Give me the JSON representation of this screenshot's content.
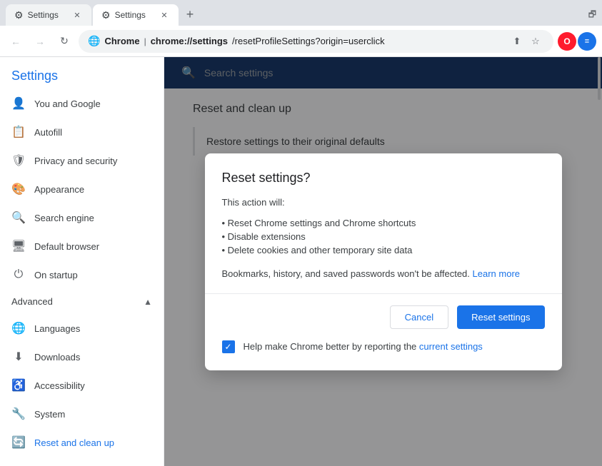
{
  "browser": {
    "tabs": [
      {
        "id": "tab1",
        "favicon": "⚙",
        "title": "Settings",
        "active": false
      },
      {
        "id": "tab2",
        "favicon": "⚙",
        "title": "Settings",
        "active": true
      }
    ],
    "new_tab_label": "+",
    "address": {
      "favicon": "🌐",
      "site": "Chrome",
      "separator": "|",
      "bold_path": "chrome://settings",
      "path": "/resetProfileSettings?origin=userclick"
    },
    "nav": {
      "back": "←",
      "forward": "→",
      "refresh": "↻"
    }
  },
  "sidebar": {
    "title": "Settings",
    "search_placeholder": "Search settings",
    "items": [
      {
        "id": "you-google",
        "icon": "👤",
        "label": "You and Google"
      },
      {
        "id": "autofill",
        "icon": "📋",
        "label": "Autofill"
      },
      {
        "id": "privacy-security",
        "icon": "🛡",
        "label": "Privacy and security"
      },
      {
        "id": "appearance",
        "icon": "🎨",
        "label": "Appearance"
      },
      {
        "id": "search-engine",
        "icon": "🔍",
        "label": "Search engine"
      },
      {
        "id": "default-browser",
        "icon": "🖥",
        "label": "Default browser"
      },
      {
        "id": "on-startup",
        "icon": "⏻",
        "label": "On startup"
      }
    ],
    "advanced_section": {
      "label": "Advanced",
      "expanded": true,
      "expand_icon": "▲"
    },
    "advanced_items": [
      {
        "id": "languages",
        "icon": "🌐",
        "label": "Languages"
      },
      {
        "id": "downloads",
        "icon": "⬇",
        "label": "Downloads"
      },
      {
        "id": "accessibility",
        "icon": "♿",
        "label": "Accessibility"
      },
      {
        "id": "system",
        "icon": "🔧",
        "label": "System"
      },
      {
        "id": "reset-clean-up",
        "icon": "🔄",
        "label": "Reset and clean up",
        "active": true
      }
    ]
  },
  "settings_page": {
    "section_title": "Reset and clean up",
    "item_label": "Restore settings to their original defaults"
  },
  "dialog": {
    "title": "Reset settings?",
    "subtitle": "This action will:",
    "list_items": [
      "• Reset Chrome settings and Chrome shortcuts",
      "• Disable extensions",
      "• Delete cookies and other temporary site data"
    ],
    "note_text": "Bookmarks, history, and saved passwords won't be affected.",
    "learn_more": "Learn more",
    "cancel_label": "Cancel",
    "reset_label": "Reset settings",
    "checkbox_checked": true,
    "checkbox_text_before": "Help make Chrome better by reporting the",
    "checkbox_link_text": "current settings"
  }
}
